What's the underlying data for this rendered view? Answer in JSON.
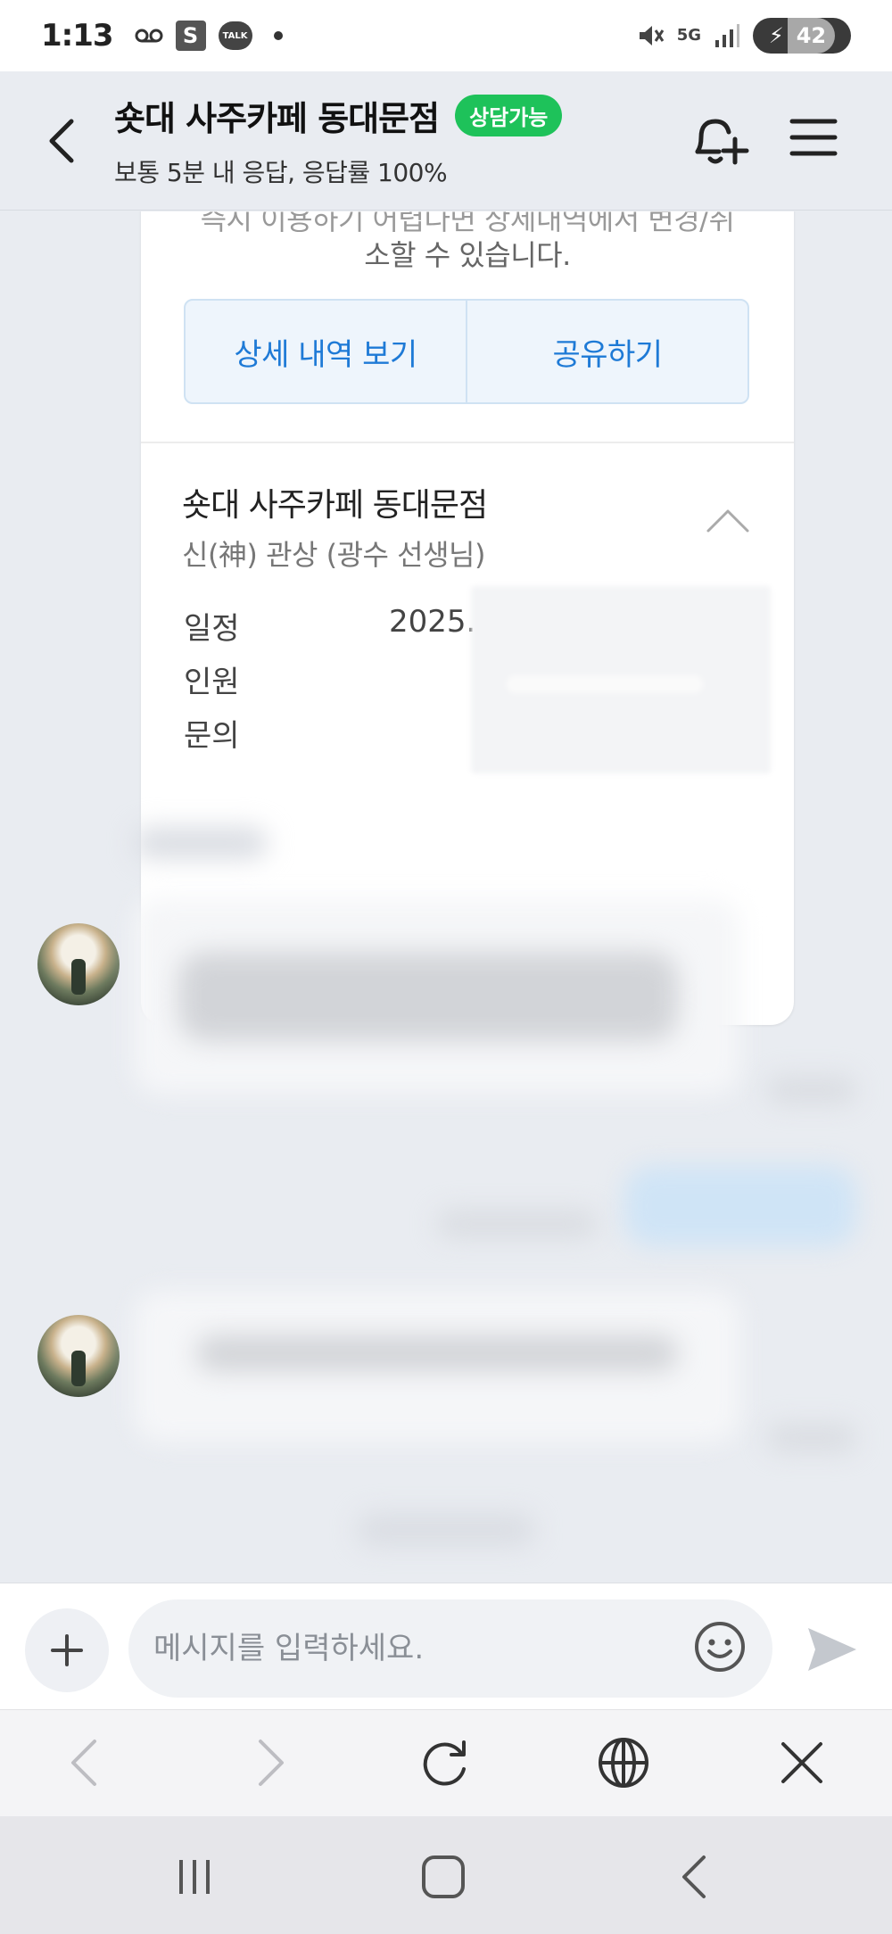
{
  "status_bar": {
    "time": "1:13",
    "icons": [
      "voicemail-icon",
      "s-app-icon",
      "kakaotalk-icon",
      "dot-icon",
      "mute-icon",
      "5g-icon",
      "signal-icon"
    ],
    "s_label": "S",
    "talk_label": "TALK",
    "network": "5G",
    "battery": "42"
  },
  "header": {
    "title": "숏대 사주카페 동대문점",
    "status_badge": "상담가능",
    "subtitle": "보통 5분 내 응답, 응답률 100%",
    "badge_color": "#1ec25a"
  },
  "card": {
    "text_cut": "즉시 이용하기 어렵다면 상세내역에서 변경/취",
    "text_line2": "소할 수 있습니다.",
    "details_button": "상세 내역 보기",
    "share_button": "공유하기",
    "shop_name": "숏대 사주카페 동대문점",
    "service": "신(神) 관상 (광수 선생님)",
    "rows": [
      {
        "label": "일정",
        "value": "2025."
      },
      {
        "label": "인원",
        "value": ""
      },
      {
        "label": "문의",
        "value": ""
      }
    ],
    "accent_color": "#1e7ad6"
  },
  "composer": {
    "placeholder": "메시지를 입력하세요."
  }
}
